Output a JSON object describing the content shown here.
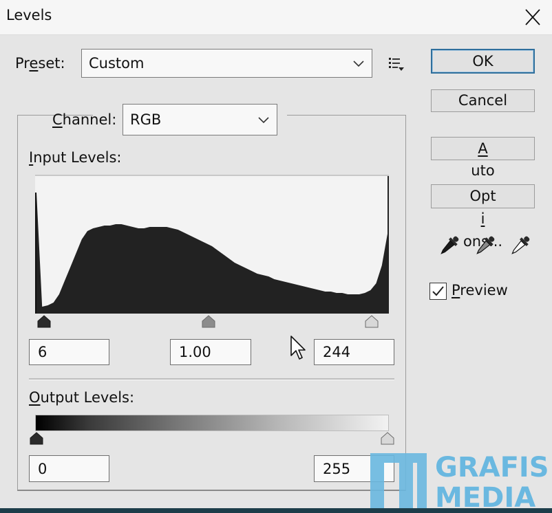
{
  "window": {
    "title": "Levels",
    "close_icon": "close-icon"
  },
  "preset": {
    "label": "Preset:",
    "value": "Custom",
    "menu_icon": "preset-options-menu-icon"
  },
  "channel": {
    "label": "Channel:",
    "value": "RGB"
  },
  "input_levels": {
    "label": "Input Levels:",
    "black_point": "6",
    "gamma": "1.00",
    "white_point": "244"
  },
  "output_levels": {
    "label": "Output Levels:",
    "black_point": "0",
    "white_point": "255"
  },
  "buttons": {
    "ok": "OK",
    "cancel": "Cancel",
    "auto": "Auto",
    "options": "Options..."
  },
  "eyedroppers": [
    {
      "name": "black-point-eyedropper-icon",
      "tone": "#1a1a1a"
    },
    {
      "name": "gray-point-eyedropper-icon",
      "tone": "#8a8a8a"
    },
    {
      "name": "white-point-eyedropper-icon",
      "tone": "#ffffff"
    }
  ],
  "preview": {
    "label": "Preview",
    "checked": true
  },
  "watermark": {
    "line1": "GRAFIS",
    "line2": "MEDIA",
    "color": "#6ab8e0"
  },
  "colors": {
    "default_button_border": "#2f6f9c",
    "histogram_fill": "#222222"
  },
  "histogram": {
    "range": [
      0,
      255
    ],
    "relative_counts": [
      0.88,
      0.05,
      0.06,
      0.08,
      0.14,
      0.24,
      0.34,
      0.44,
      0.54,
      0.6,
      0.62,
      0.63,
      0.64,
      0.64,
      0.65,
      0.65,
      0.64,
      0.63,
      0.62,
      0.62,
      0.63,
      0.63,
      0.63,
      0.63,
      0.62,
      0.61,
      0.59,
      0.57,
      0.55,
      0.53,
      0.51,
      0.49,
      0.46,
      0.43,
      0.4,
      0.37,
      0.35,
      0.33,
      0.31,
      0.29,
      0.28,
      0.27,
      0.25,
      0.24,
      0.23,
      0.22,
      0.21,
      0.2,
      0.19,
      0.18,
      0.17,
      0.16,
      0.16,
      0.15,
      0.15,
      0.14,
      0.14,
      0.14,
      0.15,
      0.17,
      0.22,
      0.35,
      0.58
    ],
    "input_sliders": {
      "black": 6,
      "gray": 125,
      "white": 244
    },
    "output_sliders": {
      "black": 0,
      "white": 255
    }
  }
}
